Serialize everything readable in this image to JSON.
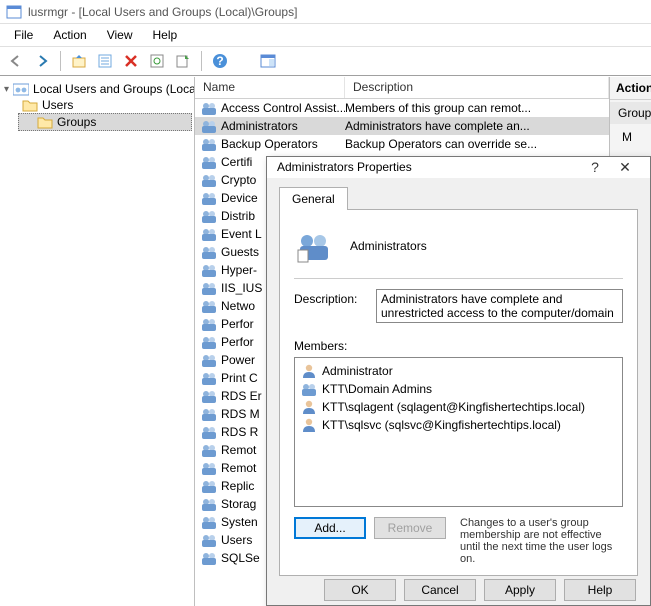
{
  "window": {
    "title": "lusrmgr - [Local Users and Groups (Local)\\Groups]"
  },
  "menubar": [
    "File",
    "Action",
    "View",
    "Help"
  ],
  "tree": {
    "root": "Local Users and Groups (Local)",
    "nodes": [
      {
        "label": "Users"
      },
      {
        "label": "Groups",
        "selected": true
      }
    ]
  },
  "list": {
    "columns": {
      "name": "Name",
      "description": "Description"
    },
    "rows": [
      {
        "name": "Access Control Assist...",
        "desc": "Members of this group can remot..."
      },
      {
        "name": "Administrators",
        "desc": "Administrators have complete an...",
        "selected": true
      },
      {
        "name": "Backup Operators",
        "desc": "Backup Operators can override se..."
      },
      {
        "name": "Certifi",
        "desc": ""
      },
      {
        "name": "Crypto",
        "desc": ""
      },
      {
        "name": "Device",
        "desc": ""
      },
      {
        "name": "Distrib",
        "desc": ""
      },
      {
        "name": "Event L",
        "desc": ""
      },
      {
        "name": "Guests",
        "desc": ""
      },
      {
        "name": "Hyper-",
        "desc": ""
      },
      {
        "name": "IIS_IUS",
        "desc": ""
      },
      {
        "name": "Netwo",
        "desc": ""
      },
      {
        "name": "Perfor",
        "desc": ""
      },
      {
        "name": "Perfor",
        "desc": ""
      },
      {
        "name": "Power",
        "desc": ""
      },
      {
        "name": "Print C",
        "desc": ""
      },
      {
        "name": "RDS Er",
        "desc": ""
      },
      {
        "name": "RDS M",
        "desc": ""
      },
      {
        "name": "RDS R",
        "desc": ""
      },
      {
        "name": "Remot",
        "desc": ""
      },
      {
        "name": "Remot",
        "desc": ""
      },
      {
        "name": "Replic",
        "desc": ""
      },
      {
        "name": "Storag",
        "desc": ""
      },
      {
        "name": "Systen",
        "desc": ""
      },
      {
        "name": "Users",
        "desc": ""
      },
      {
        "name": "SQLSe",
        "desc": ""
      }
    ]
  },
  "actions": {
    "header": "Actions",
    "group": "Groups",
    "more": "More Actions"
  },
  "dialog": {
    "title": "Administrators Properties",
    "tab": "General",
    "group_name": "Administrators",
    "desc_label": "Description:",
    "desc_value": "Administrators have complete and unrestricted access to the computer/domain",
    "members_label": "Members:",
    "members": [
      {
        "icon": "user",
        "label": "Administrator"
      },
      {
        "icon": "group",
        "label": "KTT\\Domain Admins"
      },
      {
        "icon": "user",
        "label": "KTT\\sqlagent (sqlagent@Kingfishertechtips.local)"
      },
      {
        "icon": "user",
        "label": "KTT\\sqlsvc (sqlsvc@Kingfishertechtips.local)"
      }
    ],
    "add_btn": "Add...",
    "remove_btn": "Remove",
    "note": "Changes to a user's group membership are not effective until the next time the user logs on.",
    "buttons": {
      "ok": "OK",
      "cancel": "Cancel",
      "apply": "Apply",
      "help": "Help"
    }
  }
}
